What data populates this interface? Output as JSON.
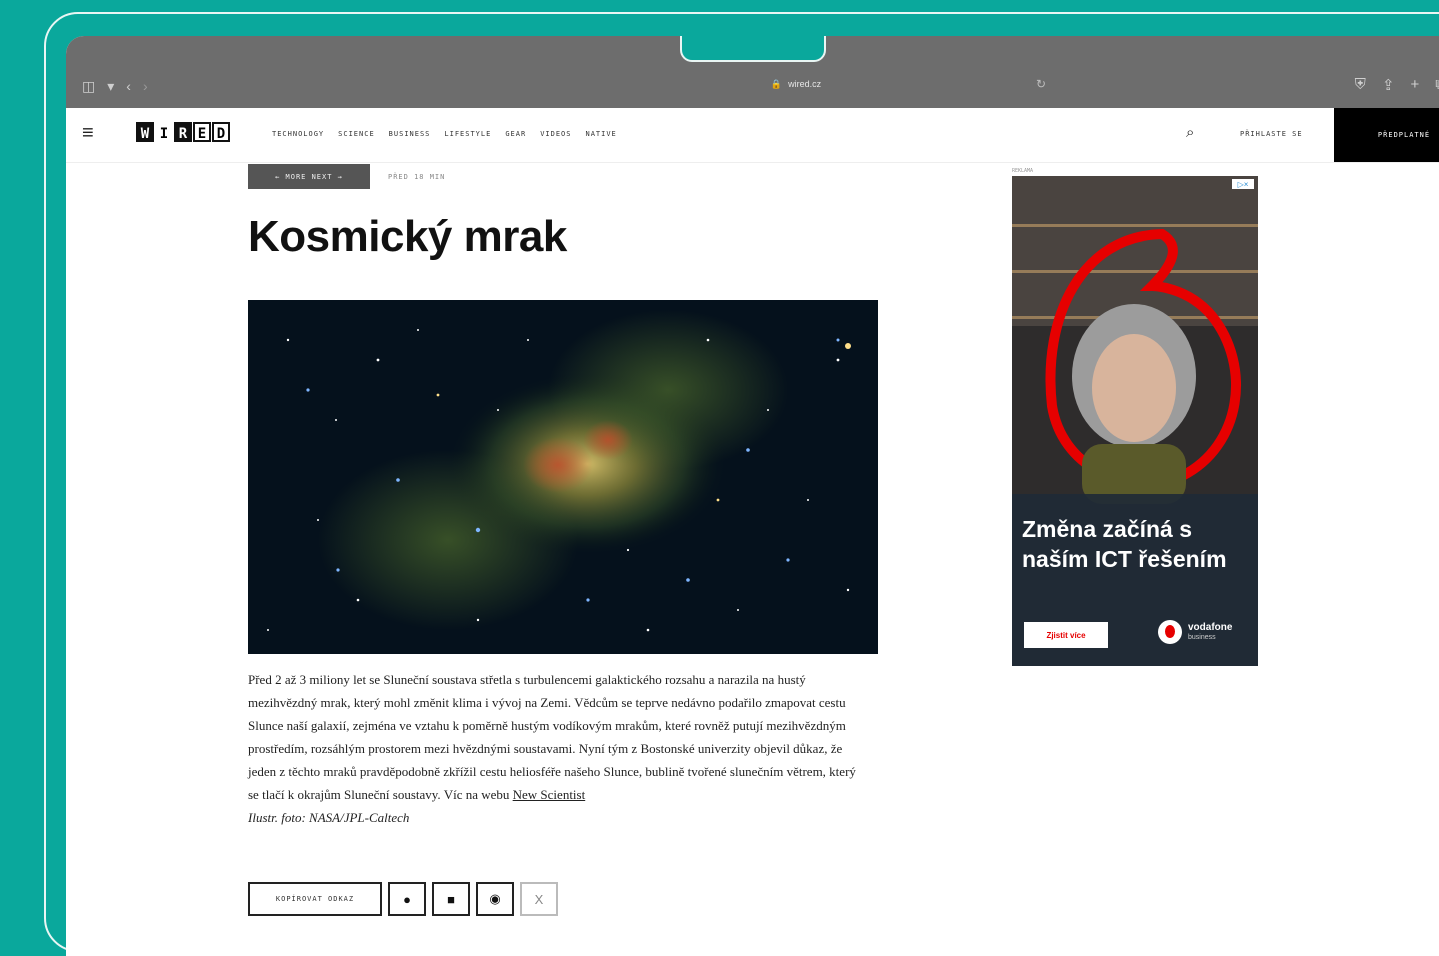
{
  "browser": {
    "url": "wired.cz"
  },
  "site": {
    "logo_letters": [
      "W",
      "I",
      "R",
      "E",
      "D"
    ],
    "nav": [
      "TECHNOLOGY",
      "SCIENCE",
      "BUSINESS",
      "LIFESTYLE",
      "GEAR",
      "VIDEOS",
      "NATIVE"
    ],
    "login": "PŘIHLASTE SE",
    "subscribe": "PŘEDPLATNÉ"
  },
  "article": {
    "more_button": "← MORE NEXT →",
    "time_ago": "PŘED 18 MIN",
    "title": "Kosmický mrak",
    "body": "Před 2 až 3 miliony let se Sluneční soustava střetla s turbulencemi galaktického rozsahu a narazila na hustý mezihvězdný mrak, který mohl změnit klima i vývoj na Zemi. Vědcům se teprve nedávno podařilo zmapovat cestu Slunce naší galaxií, zejména ve vztahu k poměrně hustým vodíkovým mrakům, které rovněž putují mezihvězdným prostředím, rozsáhlým prostorem mezi hvězdnými soustavami. Nyní tým z Bostonské univerzity objevil důkaz, že jeden z těchto mraků pravděpodobně zkřížil cestu heliosféře našeho Slunce, bublině tvořené slunečním větrem, který se tlačí k okrajům Sluneční soustavy. Víc na webu",
    "link": "New Scientist",
    "credit": "Ilustr. foto: NASA/JPL-Caltech"
  },
  "share": {
    "copy_label": "KOPÍROVAT ODKAZ",
    "x_label": "X"
  },
  "ad": {
    "label": "REKLAMA",
    "headline": "Změna začíná s naším ICT řešením",
    "cta": "Zjistit více",
    "brand": "vodafone",
    "brand_sub": "business"
  }
}
